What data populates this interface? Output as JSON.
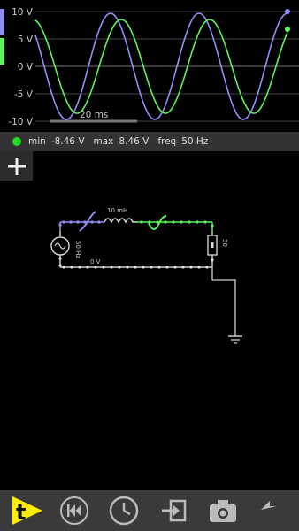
{
  "scope": {
    "y_ticks": [
      "10 V",
      "5 V",
      "0 V",
      "-5 V",
      "-10 V"
    ],
    "timescale": "20 ms",
    "colors": {
      "trace_blue": "#8f8ff5",
      "trace_green": "#5cf35c",
      "grid": "#444444"
    },
    "channel_tabs": [
      "blue",
      "green"
    ]
  },
  "status": {
    "min_label": "min",
    "min_value": "-8.46 V",
    "max_label": "max",
    "max_value": "8.46 V",
    "freq_label": "freq",
    "freq_value": "50 Hz",
    "dot_color": "#22dd22"
  },
  "circuit": {
    "inductor_label": "10 mH",
    "source_label": "50 Hz",
    "resistor_label": "50",
    "ground_node_label": "0 V"
  },
  "toolbar": {
    "buttons": [
      "t-play-icon",
      "rewind-icon",
      "clock-icon",
      "import-icon",
      "camera-icon",
      "undo-icon"
    ]
  }
}
